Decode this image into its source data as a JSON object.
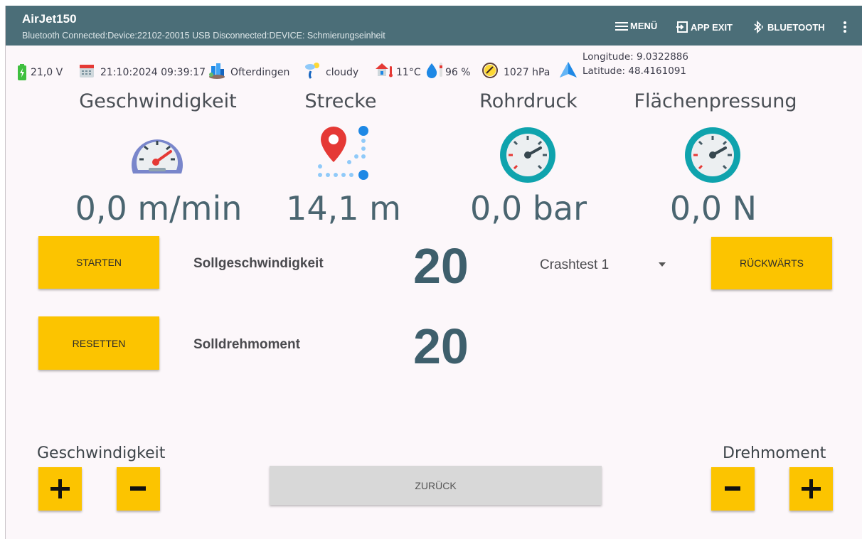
{
  "app": {
    "title": "AirJet150",
    "subtitle": "Bluetooth Connected:Device:22102-20015  USB Disconnected:DEVICE: Schmierungseinheit",
    "menu_label": "MENÜ",
    "exit_label": "APP EXIT",
    "bluetooth_label": "BLUETOOTH"
  },
  "status": {
    "voltage": "21,0 V",
    "datetime": "21:10:2024 09:39:17",
    "city": "Ofterdingen",
    "weather": "cloudy",
    "temperature": "11°C",
    "humidity": "96 %",
    "pressure": "1027 hPa",
    "longitude": "Longitude: 9.0322886",
    "latitude": "Latitude: 48.4161091"
  },
  "metrics": [
    {
      "title": "Geschwindigkeit",
      "value": "0,0 m/min",
      "icon": "speedometer-icon"
    },
    {
      "title": "Strecke",
      "value": "14,1 m",
      "icon": "route-pin-icon"
    },
    {
      "title": "Rohrdruck",
      "value": "0,0 bar",
      "icon": "pressure-gauge-icon"
    },
    {
      "title": "Flächenpressung",
      "value": "0,0 N",
      "icon": "pressure-gauge-icon"
    }
  ],
  "controls": {
    "start_label": "STARTEN",
    "reset_label": "RESETTEN",
    "reverse_label": "RÜCKWÄRTS",
    "speed_setpoint_label": "Sollgeschwindigkeit",
    "speed_setpoint_value": "20",
    "torque_setpoint_label": "Solldrehmoment",
    "torque_setpoint_value": "20",
    "program_selected": "Crashtest 1",
    "back_label": "ZURÜCK",
    "speed_group_label": "Geschwindigkeit",
    "torque_group_label": "Drehmoment"
  },
  "colors": {
    "appbar": "#4b6e78",
    "accent_yellow": "#fcc400",
    "value_text": "#3e5f6c"
  }
}
